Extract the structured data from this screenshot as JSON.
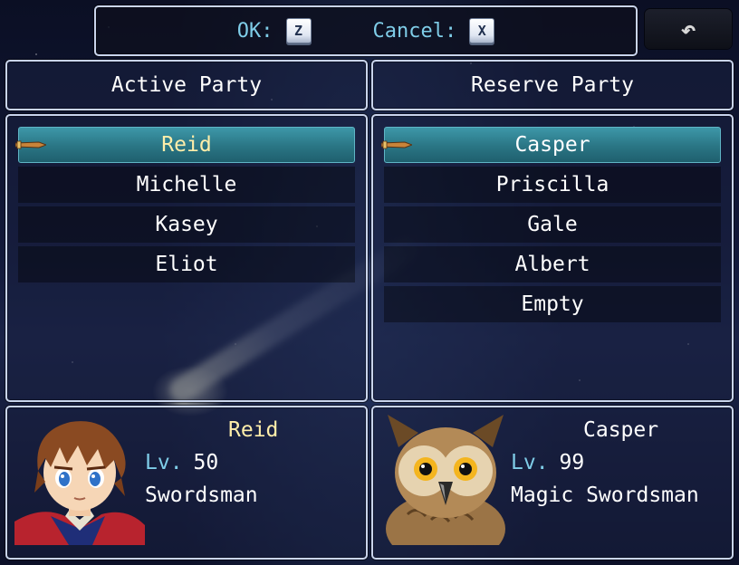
{
  "help": {
    "ok_label": "OK:",
    "ok_key": "Z",
    "cancel_label": "Cancel:",
    "cancel_key": "X"
  },
  "back_button": {
    "icon": "back-arrow-icon",
    "glyph": "↶"
  },
  "headers": {
    "active": "Active Party",
    "reserve": "Reserve Party"
  },
  "active_party": {
    "members": [
      "Reid",
      "Michelle",
      "Kasey",
      "Eliot"
    ],
    "selected_index": 0
  },
  "reserve_party": {
    "members": [
      "Casper",
      "Priscilla",
      "Gale",
      "Albert",
      "Empty"
    ],
    "selected_index": 0
  },
  "active_status": {
    "name": "Reid",
    "level_label": "Lv.",
    "level": "50",
    "class": "Swordsman",
    "portrait": "reid-portrait"
  },
  "reserve_status": {
    "name": "Casper",
    "level_label": "Lv.",
    "level": "99",
    "class": "Magic Swordsman",
    "portrait": "owl-portrait"
  },
  "colors": {
    "system_blue": "#7fcde8",
    "highlight_name": "#ffeeaa",
    "cursor_teal": "#2a7584"
  }
}
